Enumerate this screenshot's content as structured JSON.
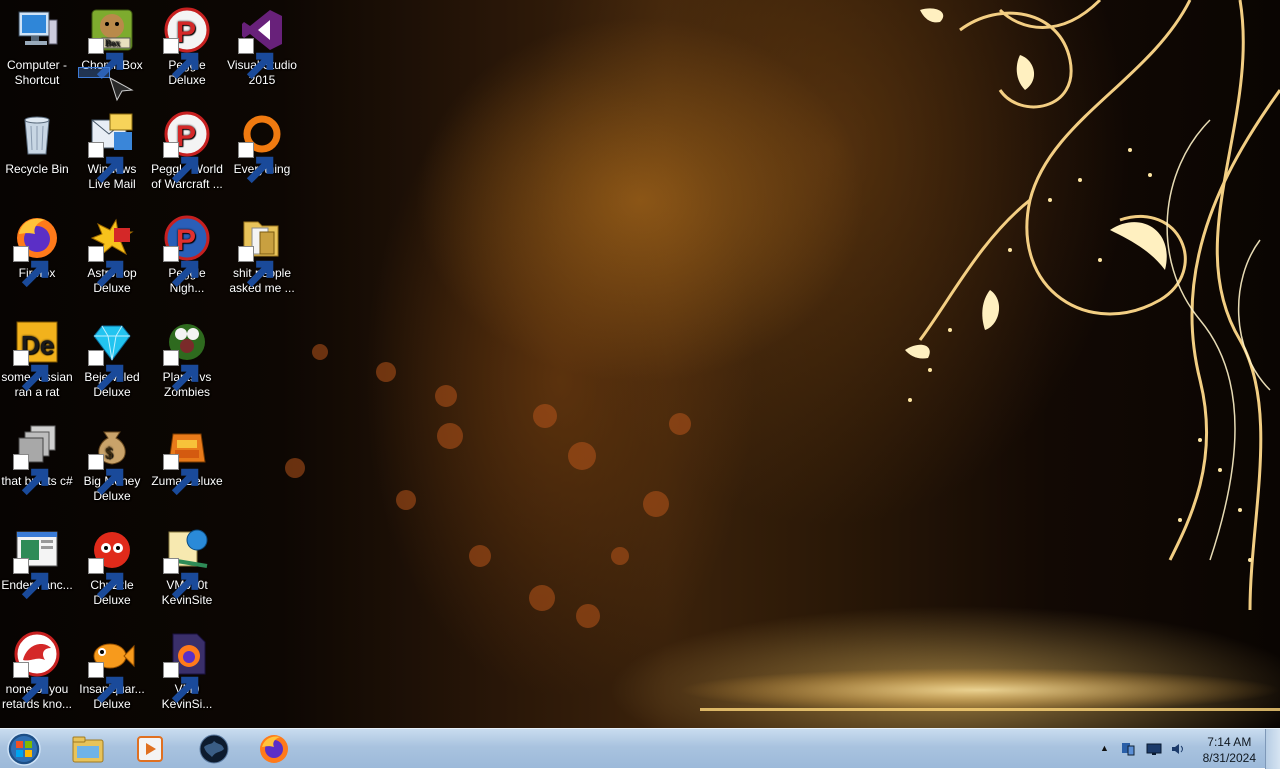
{
  "desktop": {
    "icons": [
      {
        "label": "Computer - Shortcut",
        "icon": "computer-icon",
        "shortcut": false
      },
      {
        "label": "Recycle Bin",
        "icon": "recycle-bin-icon",
        "shortcut": false
      },
      {
        "label": "Firefox",
        "icon": "firefox-icon",
        "shortcut": true
      },
      {
        "label": "some russian ran a rat",
        "icon": "de-app-icon",
        "shortcut": true
      },
      {
        "label": "that but its c#",
        "icon": "stacked-windows-icon",
        "shortcut": true
      },
      {
        "label": "Endermanc...",
        "icon": "window-app-icon",
        "shortcut": true
      },
      {
        "label": "none of you retards kno...",
        "icon": "red-dragon-icon",
        "shortcut": true
      },
      {
        "label": "ChomikBox",
        "icon": "hamster-box-icon",
        "shortcut": true
      },
      {
        "label": "Windows Live Mail",
        "icon": "mail-icon",
        "shortcut": true
      },
      {
        "label": "AstroPop Deluxe",
        "icon": "astropop-icon",
        "shortcut": true
      },
      {
        "label": "Bejeweled Deluxe",
        "icon": "diamond-icon",
        "shortcut": true
      },
      {
        "label": "Big Money Deluxe",
        "icon": "money-bag-icon",
        "shortcut": true
      },
      {
        "label": "Chuzzle Deluxe",
        "icon": "chuzzle-icon",
        "shortcut": true
      },
      {
        "label": "Insaniquar... Deluxe",
        "icon": "fish-icon",
        "shortcut": true
      },
      {
        "label": "Peggle Deluxe",
        "icon": "peggle-icon",
        "shortcut": true
      },
      {
        "label": "Peggle World of Warcraft ...",
        "icon": "peggle-icon",
        "shortcut": true
      },
      {
        "label": "Peggle Nigh...",
        "icon": "peggle-nights-icon",
        "shortcut": true
      },
      {
        "label": "Plants vs Zombies",
        "icon": "plants-vs-zombies-icon",
        "shortcut": true
      },
      {
        "label": "Zuma Deluxe",
        "icon": "zuma-icon",
        "shortcut": true
      },
      {
        "label": "VM0b0t KevinSite",
        "icon": "globe-document-icon",
        "shortcut": true
      },
      {
        "label": "VM0 KevinSi...",
        "icon": "firefox-document-icon",
        "shortcut": true
      },
      {
        "label": "Visual Studio 2015",
        "icon": "visual-studio-icon",
        "shortcut": true
      },
      {
        "label": "Everything",
        "icon": "everything-search-icon",
        "shortcut": true
      },
      {
        "label": "shit people asked me ...",
        "icon": "folder-icon",
        "shortcut": true
      }
    ]
  },
  "taskbar": {
    "start": "windows-start-orb-icon",
    "pinned": [
      {
        "name": "file-explorer-icon"
      },
      {
        "name": "media-player-icon"
      },
      {
        "name": "dark-globe-icon"
      },
      {
        "name": "firefox-icon"
      }
    ],
    "tray": {
      "expand_glyph": "▲",
      "clock_time": "7:14 AM",
      "clock_date": "8/31/2024"
    }
  }
}
